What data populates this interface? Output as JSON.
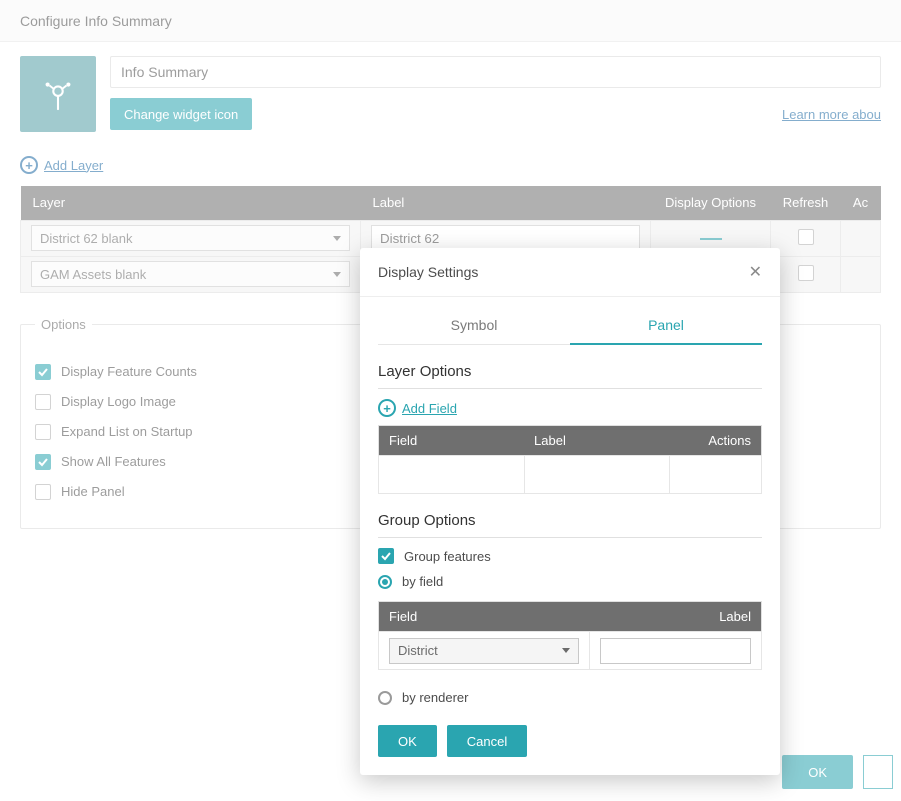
{
  "header": {
    "title": "Configure Info Summary"
  },
  "widget": {
    "title_value": "Info Summary",
    "change_icon_label": "Change widget icon",
    "learn_more_label": "Learn more abou"
  },
  "add_layer": {
    "label": "Add Layer"
  },
  "layers_table": {
    "headers": {
      "layer": "Layer",
      "label": "Label",
      "display_options": "Display Options",
      "refresh": "Refresh",
      "actions": "Ac"
    },
    "rows": [
      {
        "layer": "District 62 blank",
        "label_value": "District 62"
      },
      {
        "layer": "GAM Assets blank",
        "label_value": ""
      }
    ]
  },
  "options": {
    "legend": "Options",
    "items": [
      {
        "label": "Display Feature Counts",
        "checked": true
      },
      {
        "label": "Display Logo Image",
        "checked": false
      },
      {
        "label": "Expand List on Startup",
        "checked": false
      },
      {
        "label": "Show All Features",
        "checked": true
      },
      {
        "label": "Hide Panel",
        "checked": false
      }
    ]
  },
  "footer": {
    "ok": "OK"
  },
  "modal": {
    "title": "Display Settings",
    "tabs": {
      "symbol": "Symbol",
      "panel": "Panel"
    },
    "layer_options": {
      "title": "Layer Options",
      "add_field": "Add Field",
      "headers": {
        "field": "Field",
        "label": "Label",
        "actions": "Actions"
      }
    },
    "group_options": {
      "title": "Group Options",
      "group_features_label": "Group features",
      "by_field_label": "by field",
      "by_renderer_label": "by renderer",
      "headers": {
        "field": "Field",
        "label": "Label"
      },
      "field_value": "District"
    },
    "buttons": {
      "ok": "OK",
      "cancel": "Cancel"
    }
  }
}
